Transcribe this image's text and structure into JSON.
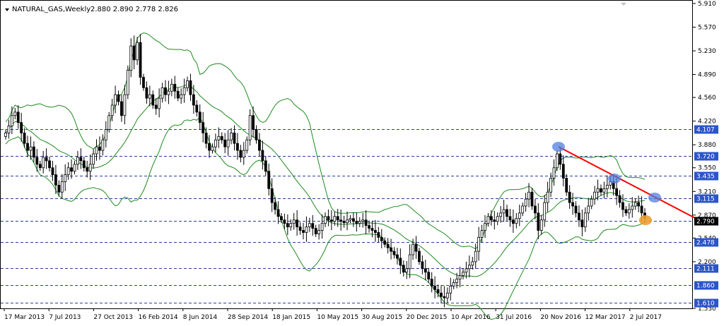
{
  "chart_data": {
    "type": "candlestick",
    "header": {
      "symbol": "NATURAL_GAS,Weekly",
      "ohlc_text": "2.880 2.890 2.778 2.826"
    },
    "y_axis": {
      "range": [
        1.53,
        5.95
      ],
      "ticks": [
        "5.910",
        "5.570",
        "5.230",
        "4.890",
        "4.560",
        "4.220",
        "3.880",
        "3.550",
        "3.210",
        "2.870",
        "2.540",
        "2.200",
        "1.530"
      ]
    },
    "x_axis": {
      "labels": [
        "17 Mar 2013",
        "7 Jul 2013",
        "27 Oct 2013",
        "16 Feb 2014",
        "8 Jun 2014",
        "28 Sep 2014",
        "18 Jan 2015",
        "10 May 2015",
        "30 Aug 2015",
        "20 Dec 2015",
        "10 Apr 2016",
        "31 Jul 2016",
        "20 Nov 2016",
        "12 Mar 2017",
        "2 Jul 2017"
      ]
    },
    "horizontal_levels": [
      "4.107",
      "3.720",
      "3.435",
      "3.115",
      "2.790",
      "2.478",
      "2.111",
      "1.860",
      "1.610"
    ],
    "current_price": "2.790",
    "close_prices": [
      4.05,
      4.15,
      4.3,
      4.35,
      4.2,
      4.05,
      3.9,
      3.8,
      3.85,
      3.7,
      3.6,
      3.55,
      3.7,
      3.65,
      3.55,
      3.45,
      3.3,
      3.2,
      3.35,
      3.45,
      3.55,
      3.5,
      3.6,
      3.7,
      3.65,
      3.55,
      3.5,
      3.6,
      3.75,
      3.85,
      3.8,
      3.95,
      4.1,
      4.3,
      4.45,
      4.6,
      4.5,
      4.3,
      4.6,
      4.95,
      5.3,
      5.1,
      5.35,
      4.85,
      4.7,
      4.55,
      4.6,
      4.45,
      4.4,
      4.55,
      4.7,
      4.6,
      4.65,
      4.75,
      4.65,
      4.55,
      4.6,
      4.7,
      4.8,
      4.6,
      4.45,
      4.35,
      4.2,
      4.05,
      3.9,
      3.8,
      3.85,
      3.95,
      4.0,
      3.95,
      3.85,
      3.95,
      4.05,
      3.9,
      3.8,
      3.7,
      3.8,
      3.95,
      4.3,
      4.1,
      3.95,
      3.8,
      3.65,
      3.5,
      3.25,
      3.05,
      2.95,
      2.85,
      2.8,
      2.75,
      2.7,
      2.75,
      2.8,
      2.7,
      2.65,
      2.62,
      2.7,
      2.75,
      2.68,
      2.6,
      2.65,
      2.75,
      2.85,
      2.8,
      2.78,
      2.85,
      2.8,
      2.78,
      2.76,
      2.8,
      2.82,
      2.78,
      2.75,
      2.78,
      2.8,
      2.72,
      2.68,
      2.65,
      2.62,
      2.55,
      2.5,
      2.45,
      2.4,
      2.35,
      2.3,
      2.25,
      2.15,
      2.05,
      2.1,
      2.3,
      2.45,
      2.35,
      2.2,
      2.1,
      2.05,
      1.95,
      1.85,
      1.8,
      1.75,
      1.7,
      1.68,
      1.75,
      1.85,
      1.9,
      1.95,
      2.0,
      2.05,
      2.1,
      2.15,
      2.2,
      2.35,
      2.55,
      2.65,
      2.75,
      2.85,
      2.8,
      2.78,
      2.85,
      2.9,
      2.95,
      2.85,
      2.8,
      2.75,
      2.82,
      2.9,
      3.0,
      3.1,
      3.2,
      3.0,
      2.9,
      2.65,
      2.8,
      3.05,
      3.2,
      3.4,
      3.55,
      3.75,
      3.6,
      3.4,
      3.2,
      3.05,
      3.0,
      2.9,
      2.8,
      2.7,
      2.9,
      3.0,
      3.1,
      3.2,
      3.25,
      3.2,
      3.25,
      3.3,
      3.35,
      3.25,
      3.15,
      3.05,
      2.95,
      2.9,
      2.95,
      3.0,
      3.05,
      3.0,
      2.9,
      2.82
    ]
  }
}
